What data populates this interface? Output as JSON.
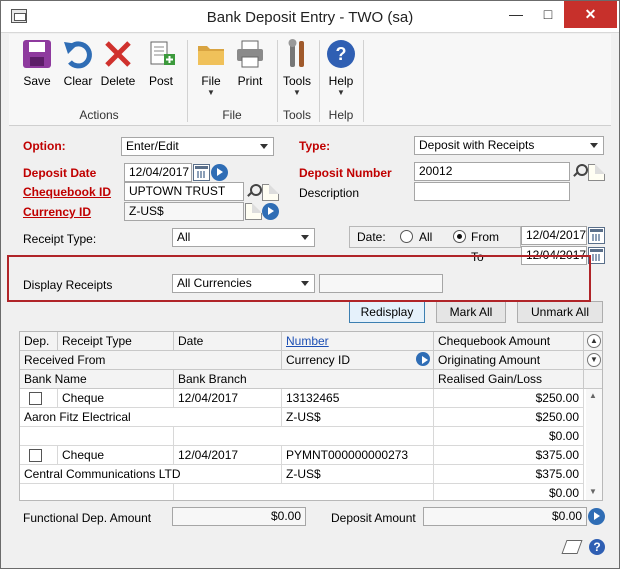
{
  "window": {
    "title": "Bank Deposit Entry  -  TWO (sa)"
  },
  "ribbon": {
    "actions": {
      "save": "Save",
      "clear": "Clear",
      "delete": "Delete",
      "post": "Post",
      "group": "Actions"
    },
    "file": {
      "file": "File",
      "print": "Print",
      "group": "File"
    },
    "tools": {
      "tools": "Tools",
      "group": "Tools"
    },
    "help": {
      "help": "Help",
      "group": "Help"
    }
  },
  "form": {
    "option_label": "Option:",
    "option_value": "Enter/Edit",
    "type_label": "Type:",
    "type_value": "Deposit with Receipts",
    "deposit_date_label": "Deposit Date",
    "deposit_date_value": "12/04/2017",
    "deposit_number_label": "Deposit Number",
    "deposit_number_value": "20012",
    "chequebook_label": "Chequebook ID",
    "chequebook_value": "UPTOWN TRUST",
    "description_label": "Description",
    "description_value": "",
    "currency_label": "Currency ID",
    "currency_value": "Z-US$",
    "receipt_type_label": "Receipt Type:",
    "receipt_type_value": "All",
    "date_label": "Date:",
    "date_all": "All",
    "date_from": "From",
    "date_to": "To",
    "date_from_value": "12/04/2017",
    "date_to_value": "12/04/2017",
    "display_receipts_label": "Display Receipts",
    "display_receipts_value": "All Currencies",
    "redisplay": "Redisplay",
    "mark_all": "Mark All",
    "unmark_all": "Unmark All"
  },
  "grid": {
    "headers": {
      "dep": "Dep.",
      "receipt_type": "Receipt Type",
      "date": "Date",
      "number": "Number",
      "chequebook_amount": "Chequebook Amount",
      "received_from": "Received From",
      "currency_id": "Currency ID",
      "originating_amount": "Originating Amount",
      "bank_name": "Bank Name",
      "bank_branch": "Bank Branch",
      "realised": "Realised Gain/Loss"
    },
    "rows": [
      {
        "type": "Cheque",
        "date": "12/04/2017",
        "number": "13132465",
        "amount": "$250.00",
        "from": "Aaron Fitz Electrical",
        "currency": "Z-US$",
        "orig": "$250.00",
        "realised": "$0.00"
      },
      {
        "type": "Cheque",
        "date": "12/04/2017",
        "number": "PYMNT000000000273",
        "amount": "$375.00",
        "from": "Central Communications LTD",
        "currency": "Z-US$",
        "orig": "$375.00",
        "realised": "$0.00"
      }
    ]
  },
  "footer": {
    "functional_label": "Functional Dep. Amount",
    "functional_value": "$0.00",
    "deposit_amount_label": "Deposit Amount",
    "deposit_amount_value": "$0.00"
  }
}
